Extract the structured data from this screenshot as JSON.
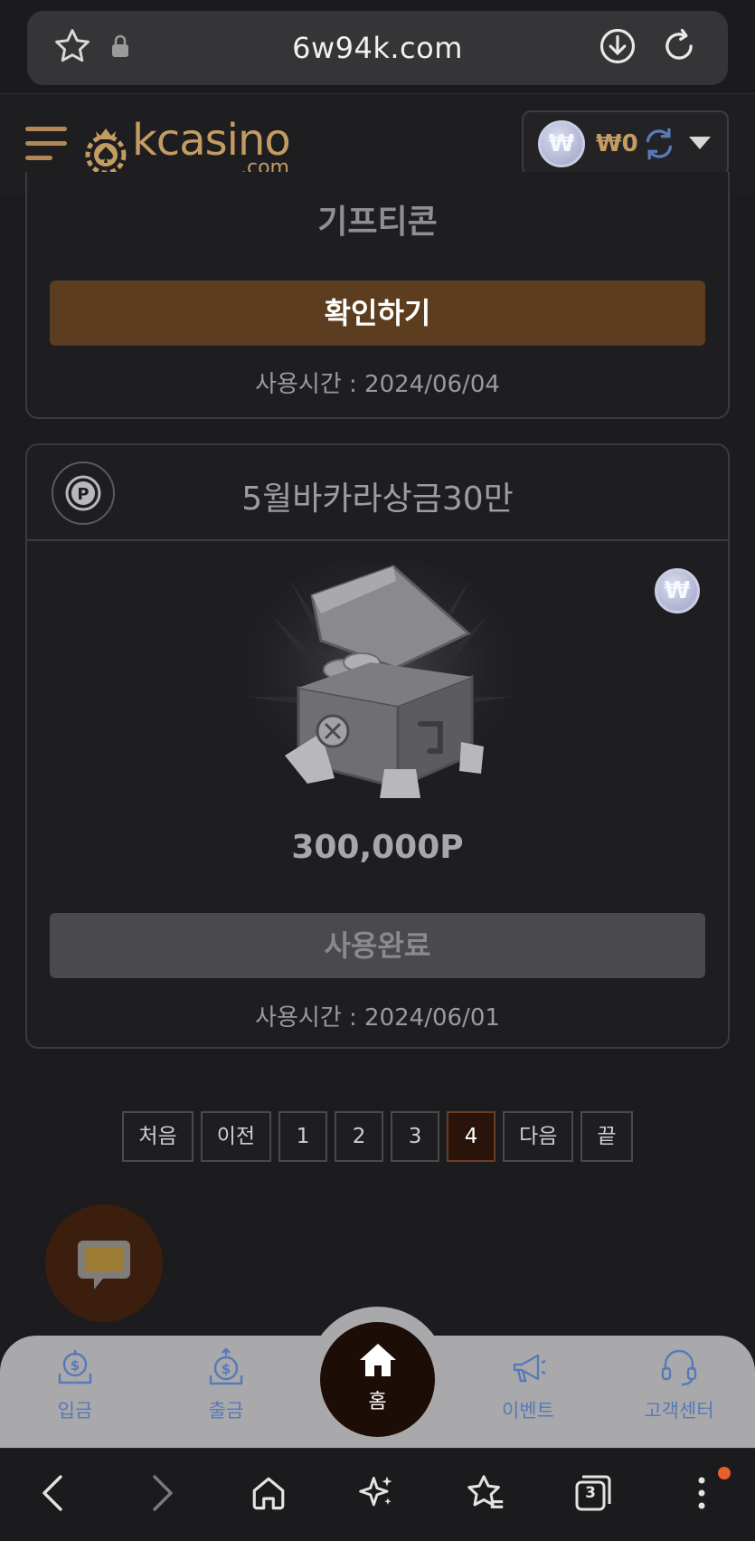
{
  "browser": {
    "url": "6w94k.com",
    "tab_count": "3"
  },
  "header": {
    "logo_main": "kcasino",
    "logo_sub": ".com",
    "balance_symbol": "₩",
    "balance_value": "₩0"
  },
  "coupons": [
    {
      "title": "기프티콘",
      "button_label": "확인하기",
      "used_time": "사용시간 : 2024/06/04",
      "button_color": "#5c3d1f"
    },
    {
      "title": "5월바카라상금30만",
      "amount": "300,000P",
      "button_label": "사용완료",
      "used_time": "사용시간 : 2024/06/01",
      "button_color": "#4a4a4c",
      "badge_symbol": "₩"
    }
  ],
  "pagination": {
    "first": "처음",
    "prev": "이전",
    "pages": [
      "1",
      "2",
      "3",
      "4"
    ],
    "current": "4",
    "next": "다음",
    "last": "끝"
  },
  "bottom_nav": {
    "deposit": "입금",
    "withdraw": "출금",
    "home": "홈",
    "event": "이벤트",
    "support": "고객센터"
  },
  "colors": {
    "accent_gold": "#c49b63",
    "nav_blue": "#5879b8",
    "active_page": "#2a130b"
  }
}
